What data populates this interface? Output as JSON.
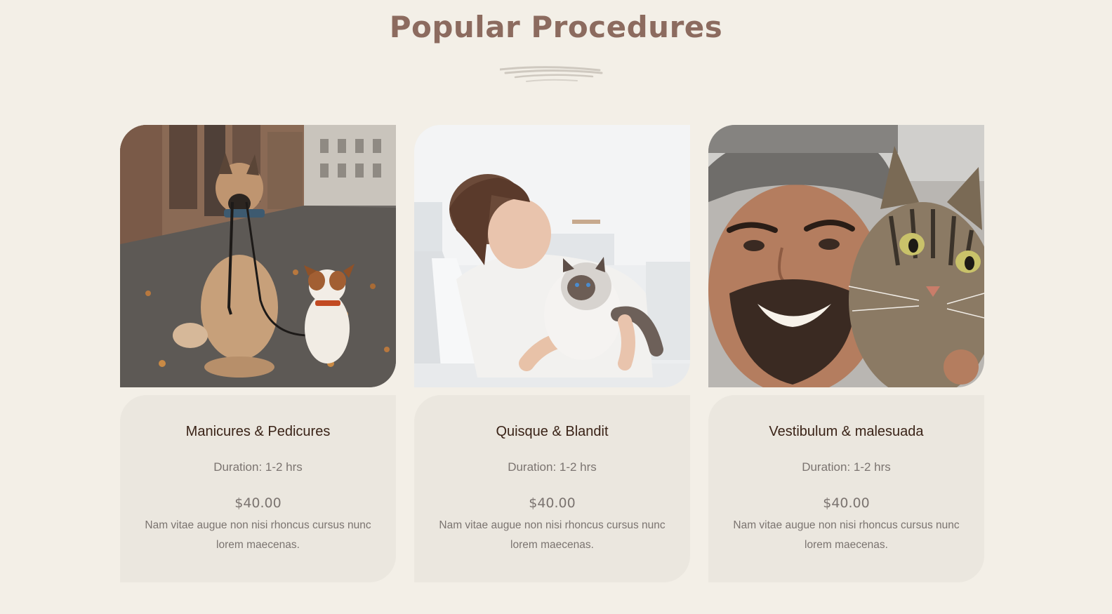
{
  "section": {
    "title": "Popular Procedures",
    "underline_icon": "brush-stroke-lines-icon"
  },
  "colors": {
    "background": "#f3efe7",
    "title": "#8c6b5f",
    "card_body": "#ebe7df",
    "card_name": "#3a2317",
    "card_text": "#7b7470"
  },
  "cards": [
    {
      "image_icon": "dogs-on-leash-photo",
      "name": "Manicures & Pedicures",
      "duration": "Duration: 1-2 hrs",
      "price": "$40.00",
      "description": "Nam vitae augue non nisi rhoncus cursus nunc lorem maecenas."
    },
    {
      "image_icon": "woman-with-cat-photo",
      "name": "Quisque & Blandit",
      "duration": "Duration: 1-2 hrs",
      "price": "$40.00",
      "description": "Nam vitae augue non nisi rhoncus cursus nunc lorem maecenas."
    },
    {
      "image_icon": "man-with-tabby-cat-photo",
      "name": "Vestibulum & malesuada",
      "duration": "Duration: 1-2 hrs",
      "price": "$40.00",
      "description": "Nam vitae augue non nisi rhoncus cursus nunc lorem maecenas."
    }
  ]
}
